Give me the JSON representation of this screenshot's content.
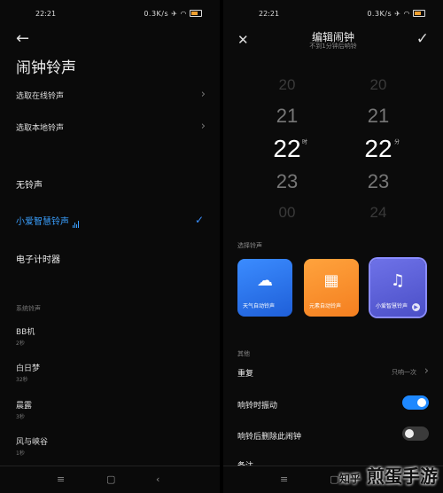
{
  "status_bar": {
    "time": "22:21",
    "net": "0.3K/s"
  },
  "left": {
    "title": "闹钟铃声",
    "browse_rows": [
      {
        "label": "选取在线铃声"
      },
      {
        "label": "选取本地铃声"
      }
    ],
    "ringtones": [
      "无铃声",
      "小爱智慧铃声",
      "电子计时器"
    ],
    "selected_ringtone": "小爱智慧铃声",
    "system_section": "系统铃声",
    "system_ringtones": [
      {
        "name": "BB机",
        "size": "2秒"
      },
      {
        "name": "白日梦",
        "size": "32秒"
      },
      {
        "name": "晨露",
        "size": "3秒"
      },
      {
        "name": "风与峡谷",
        "size": "1秒"
      }
    ]
  },
  "right": {
    "title": "编辑闹钟",
    "subtitle": "不到1分钟后响铃",
    "hours": [
      "20",
      "21",
      "22",
      "23",
      "00"
    ],
    "minutes": [
      "20",
      "21",
      "22",
      "23",
      "24"
    ],
    "hour_unit": "时",
    "minute_unit": "分",
    "ringtone_section": "选择铃声",
    "ringtone_cards": [
      {
        "label": "天气自动铃声",
        "icon": "cloud-icon",
        "color": "#2f7cf0"
      },
      {
        "label": "元素自动铃声",
        "icon": "grid-icon",
        "color": "#f7932b"
      },
      {
        "label": "小爱智慧铃声",
        "icon": "music-note-icon",
        "color": "#5b5fd6"
      }
    ],
    "other_section": "其他",
    "repeat_label": "重复",
    "repeat_value": "只响一次",
    "vibrate_label": "响铃时振动",
    "vibrate_on": true,
    "delete_label": "响铃后删除此闹钟",
    "delete_on": false,
    "note_label": "备注"
  },
  "watermark": "煎蛋手游",
  "watermark_small": "知乎"
}
